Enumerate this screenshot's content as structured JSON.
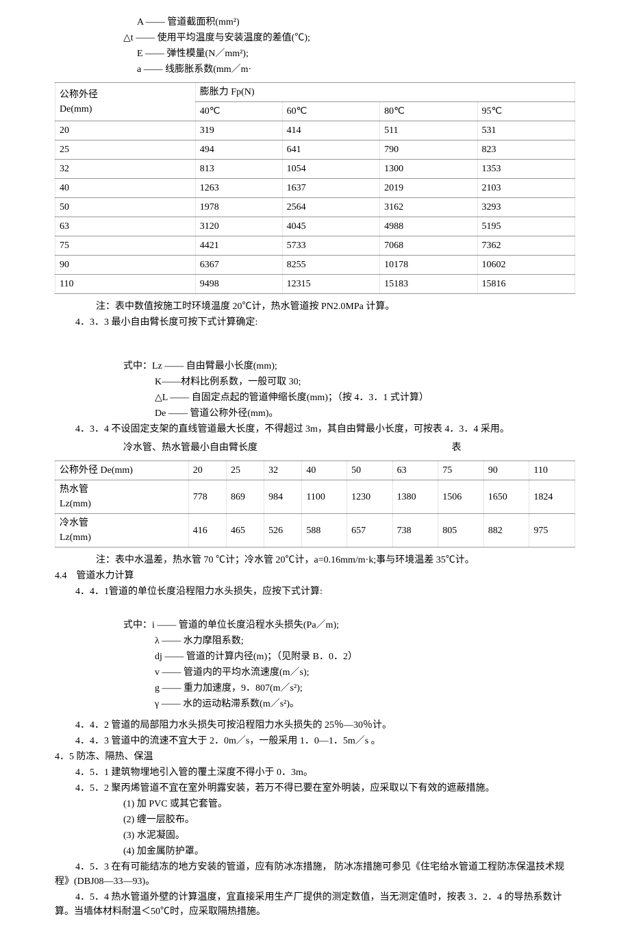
{
  "defs": {
    "A": "A —— 管道截面积(mm²)",
    "dt": "△t —— 使用平均温度与安装温度的差值(℃);",
    "E": "E —— 弹性模量(N／mm²);",
    "a": "a —— 线膨胀系数(mm／m·"
  },
  "table1": {
    "headers": {
      "col1_line1": "公称外径",
      "col1_line2": "De(mm)",
      "span_header": "膨胀力 Fp(N)",
      "t40": "40℃",
      "t60": "60℃",
      "t80": "80℃",
      "t95": "95℃"
    },
    "rows": [
      {
        "de": "20",
        "v40": "319",
        "v60": "414",
        "v80": "511",
        "v95": "531"
      },
      {
        "de": "25",
        "v40": "494",
        "v60": "641",
        "v80": "790",
        "v95": "823"
      },
      {
        "de": "32",
        "v40": "813",
        "v60": "1054",
        "v80": "1300",
        "v95": "1353"
      },
      {
        "de": "40",
        "v40": "1263",
        "v60": "1637",
        "v80": "2019",
        "v95": "2103"
      },
      {
        "de": "50",
        "v40": "1978",
        "v60": "2564",
        "v80": "3162",
        "v95": "3293"
      },
      {
        "de": "63",
        "v40": "3120",
        "v60": "4045",
        "v80": "4988",
        "v95": "5195"
      },
      {
        "de": "75",
        "v40": "4421",
        "v60": "5733",
        "v80": "7068",
        "v95": "7362"
      },
      {
        "de": "90",
        "v40": "6367",
        "v60": "8255",
        "v80": "10178",
        "v95": "10602"
      },
      {
        "de": "110",
        "v40": "9498",
        "v60": "12315",
        "v80": "15183",
        "v95": "15816"
      }
    ]
  },
  "note1": "注：表中数值按施工时环境温度 20℃计，热水管道按 PN2.0MPa 计算。",
  "s433": "4．3．3 最小自由臂长度可按下式计算确定:",
  "s433_defs_intro": "式中：Lz —— 自由臂最小长度(mm);",
  "s433_defs_k": "K——材料比例系数，一般可取 30;",
  "s433_defs_dl": "△L —— 自固定点起的管道伸缩长度(mm)；（按 4．3．1 式计算）",
  "s433_defs_de": "De —— 管道公称外径(mm)。",
  "s434": "4．3．4 不设固定支架的直线管道最大长度，不得超过 3m，其自由臂最小长度，可按表 4．3．4 采用。",
  "table2_title": "冷水管、热水管最小自由臂长度",
  "table2_label": "表",
  "table2": {
    "h_de": "公称外径 De(mm)",
    "h_hot1": "热水管",
    "h_hot2": "Lz(mm)",
    "h_cold1": "冷水管",
    "h_cold2": "Lz(mm)",
    "cols": [
      "20",
      "25",
      "32",
      "40",
      "50",
      "63",
      "75",
      "90",
      "110"
    ],
    "hot": [
      "778",
      "869",
      "984",
      "1100",
      "1230",
      "1380",
      "1506",
      "1650",
      "1824"
    ],
    "cold": [
      "416",
      "465",
      "526",
      "588",
      "657",
      "738",
      "805",
      "882",
      "975"
    ]
  },
  "note2": "注：表中水温差，热水管 70 ℃计；冷水管 20℃计，a=0.16mm/m·k;事与环境温差 35℃计。",
  "s44": "4.4　管道水力计算",
  "s441": "4．4．1管道的单位长度沿程阻力水头损失，应按下式计算:",
  "s441_intro": "式中：i —— 管道的单位长度沿程水头损失(Pa／m);",
  "s441_lambda": "λ —— 水力摩阻系数;",
  "s441_dj": "dj —— 管道的计算内径(m)；（见附录 B．0．2）",
  "s441_v": "v —— 管道内的平均水流速度(m／s);",
  "s441_g": "g —— 重力加速度，9．807(m／s²);",
  "s441_gamma": "γ —— 水的运动粘滞系数(m／s²)。",
  "s442": "4．4．2 管道的局部阻力水头损失可按沿程阻力水头损失的 25％—30％计。",
  "s443": "4．4．3 管道中的流速不宜大于 2．0m／s，一般采用 1．0—1．5m／s 。",
  "s45": "4．5 防冻、隔热、保温",
  "s451": "4．5．1 建筑物埋地引入管的覆土深度不得小于 0．3m。",
  "s452": "4．5．2 聚丙烯管道不宜在室外明露安装，若万不得已要在室外明装，应采取以下有效的遮蔽措施。",
  "s452_1": "(1)  加 PVC 或其它套管。",
  "s452_2": "(2)  缠一层胶布。",
  "s452_3": "(3)  水泥凝固。",
  "s452_4": "(4)  加金属防护罩。",
  "s453": "4．5．3 在有可能结冻的地方安装的管道，应有防冰冻措施， 防冰冻措施可参见《住宅给水管道工程防冻保温技术规程》(DBJ08—33—93)。",
  "s454": "4．5．4 热水管道外壁的计算温度，宜直接采用生产厂提供的测定数值，当无测定值时，按表 3．2．4 的导热系数计算。当墙体材料耐温＜50℃时，应采取隔热措施。"
}
